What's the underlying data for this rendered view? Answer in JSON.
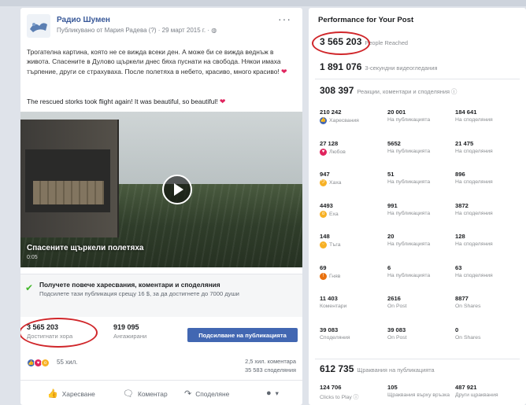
{
  "post": {
    "page_name": "Радио Шумен",
    "meta": "Публикувано от Мария Радева (?) · 29 март 2015 г. · ",
    "more": "···",
    "text_bg": "Трогателна картина, която не се вижда всеки ден. А може би се вижда веднъж в живота. Спасените в Дулово щъркели днес бяха пуснати на свобода. Някои имаха търпение, други се страхуваха. После полетяха в небето, красиво, много красиво! ",
    "text_en": "The rescued storks took flight again! It was beautiful, so beautiful! ",
    "video_caption": "Спасените щъркели полетяха",
    "video_sub": "0:05",
    "boost_title": "Получете повече харесвания, коментари и споделяния",
    "boost_sub": "Подсилете тази публикация срещу 16 $, за да достигнете до 7000 души",
    "reached_num": "3 565 203",
    "reached_label": "Достигнати хора",
    "engagement_num": "919 095",
    "engagement_label": "Ангажирани",
    "boost_button": "Подсилване на публикацията",
    "reaction_count": "55 хил.",
    "comments_count": "2,5 хил. коментара",
    "shares_count": "35 583 споделяния",
    "actions": {
      "like": "Харесване",
      "comment": "Коментар",
      "share": "Споделяне",
      "more": "▾"
    }
  },
  "perf": {
    "title": "Performance for Your Post",
    "reached_num": "3 565 203",
    "reached_label": "People Reached",
    "views_num": "1 891 076",
    "views_label": "3-секундни видеогледания",
    "reactions_num": "308 397",
    "reactions_label": "Реакции, коментари и споделяния ⓘ",
    "rows": [
      {
        "cells": [
          {
            "num": "210 242",
            "lbl": "Харесвания",
            "icon": "like"
          },
          {
            "num": "20 001",
            "lbl": "На публикацията"
          },
          {
            "num": "184 641",
            "lbl": "На споделяния"
          }
        ]
      },
      {
        "cells": [
          {
            "num": "27 128",
            "lbl": "Любов",
            "icon": "love"
          },
          {
            "num": "5652",
            "lbl": "На публикацията"
          },
          {
            "num": "21 475",
            "lbl": "На споделяния"
          }
        ]
      },
      {
        "cells": [
          {
            "num": "947",
            "lbl": "Хаха",
            "icon": "haha"
          },
          {
            "num": "51",
            "lbl": "На публикацията"
          },
          {
            "num": "896",
            "lbl": "На споделяния"
          }
        ]
      },
      {
        "cells": [
          {
            "num": "4493",
            "lbl": "Еха",
            "icon": "wow"
          },
          {
            "num": "991",
            "lbl": "На публикацията"
          },
          {
            "num": "3872",
            "lbl": "На споделяния"
          }
        ]
      },
      {
        "cells": [
          {
            "num": "148",
            "lbl": "Тъга",
            "icon": "sad"
          },
          {
            "num": "20",
            "lbl": "На публикацията"
          },
          {
            "num": "128",
            "lbl": "На споделяния"
          }
        ]
      },
      {
        "cells": [
          {
            "num": "69",
            "lbl": "Гняв",
            "icon": "angry"
          },
          {
            "num": "6",
            "lbl": "На публикацията"
          },
          {
            "num": "63",
            "lbl": "На споделяния"
          }
        ]
      },
      {
        "cells": [
          {
            "num": "11 403",
            "lbl": "Коментари"
          },
          {
            "num": "2616",
            "lbl": "On Post"
          },
          {
            "num": "8877",
            "lbl": "On Shares"
          }
        ]
      },
      {
        "cells": [
          {
            "num": "39 083",
            "lbl": "Споделяния"
          },
          {
            "num": "39 083",
            "lbl": "On Post"
          },
          {
            "num": "0",
            "lbl": "On Shares"
          }
        ]
      }
    ],
    "clicks_num": "612 735",
    "clicks_label": "Щраквания на публикацията",
    "bottom": [
      {
        "num": "124 706",
        "lbl": "Clicks to Play ⓘ"
      },
      {
        "num": "105",
        "lbl": "Щраквания върху връзка"
      },
      {
        "num": "487 921",
        "lbl": "Други щраквания"
      }
    ]
  },
  "colors": {
    "fb_blue": "#4267b2",
    "annotation_red": "#d0262a",
    "check_green": "#42b72a"
  }
}
